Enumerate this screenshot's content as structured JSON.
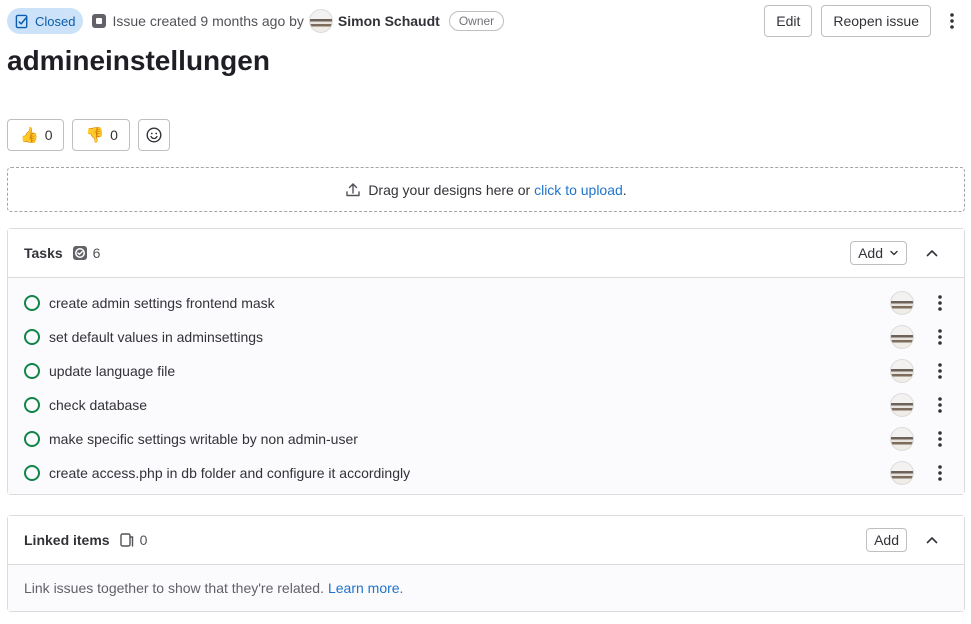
{
  "header": {
    "status": "Closed",
    "meta_prefix": "Issue created 9 months ago by",
    "author": "Simon Schaudt",
    "role": "Owner",
    "edit_label": "Edit",
    "reopen_label": "Reopen issue"
  },
  "issue": {
    "title": "admineinstellungen"
  },
  "reactions": [
    {
      "emoji": "👍",
      "count": "0"
    },
    {
      "emoji": "👎",
      "count": "0"
    }
  ],
  "dropzone": {
    "text": "Drag your designs here or",
    "link": "click to upload",
    "suffix": "."
  },
  "tasks": {
    "title": "Tasks",
    "count": "6",
    "add_label": "Add",
    "items": [
      {
        "title": "create admin settings frontend mask"
      },
      {
        "title": "set default values in adminsettings"
      },
      {
        "title": "update language file"
      },
      {
        "title": "check database"
      },
      {
        "title": "make specific settings writable by non admin-user"
      },
      {
        "title": "create access.php in db folder and configure it accordingly"
      }
    ]
  },
  "linked": {
    "title": "Linked items",
    "count": "0",
    "add_label": "Add",
    "empty_text": "Link issues together to show that they're related.",
    "learn_more": "Learn more."
  },
  "colors": {
    "status_bg": "#cbe2f9",
    "status_fg": "#0b5cad",
    "task_open": "#108548",
    "link": "#1f75cb"
  }
}
